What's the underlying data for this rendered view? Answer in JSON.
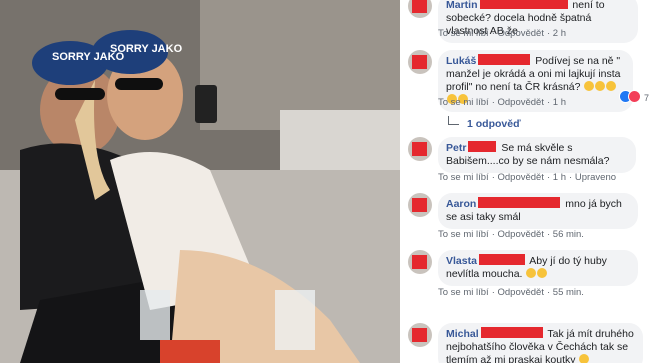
{
  "photo": {
    "cap_text": "SORRY JAKO"
  },
  "comments": [
    {
      "name": "Martin",
      "text_before": "není to sobecké? docela hodně špatná vlastnost AB že",
      "like": "To se mi líbí",
      "reply": "Odpovědět",
      "time": "2 h"
    },
    {
      "name": "Lukáš",
      "text": "Podívej se na ně \" manžel je okrádá a oni mi lajkují insta profil\" no není ta ČR krásná?",
      "like": "To se mi líbí",
      "reply": "Odpovědět",
      "time": "1 h",
      "reaction_count": "7",
      "replies": "1 odpověď"
    },
    {
      "name": "Petr",
      "text": "Se má skvěle s Babišem....co by se nám nesmála?",
      "like": "To se mi líbí",
      "reply": "Odpovědět",
      "time": "1 h",
      "edited": "Upraveno"
    },
    {
      "name": "Aaron",
      "text": "mno já bych se asi taky smál",
      "like": "To se mi líbí",
      "reply": "Odpovědět",
      "time": "56 min."
    },
    {
      "name": "Vlasta",
      "text": "Aby jí do tý huby nevlítla moucha.",
      "like": "To se mi líbí",
      "reply": "Odpovědět",
      "time": "55 min."
    },
    {
      "name": "Michal",
      "text": "Tak já mít druhého nejbohatšího člověka v Čechách tak se tlemím až mi praskaj koutky",
      "like": "",
      "reply": "",
      "time": ""
    }
  ]
}
